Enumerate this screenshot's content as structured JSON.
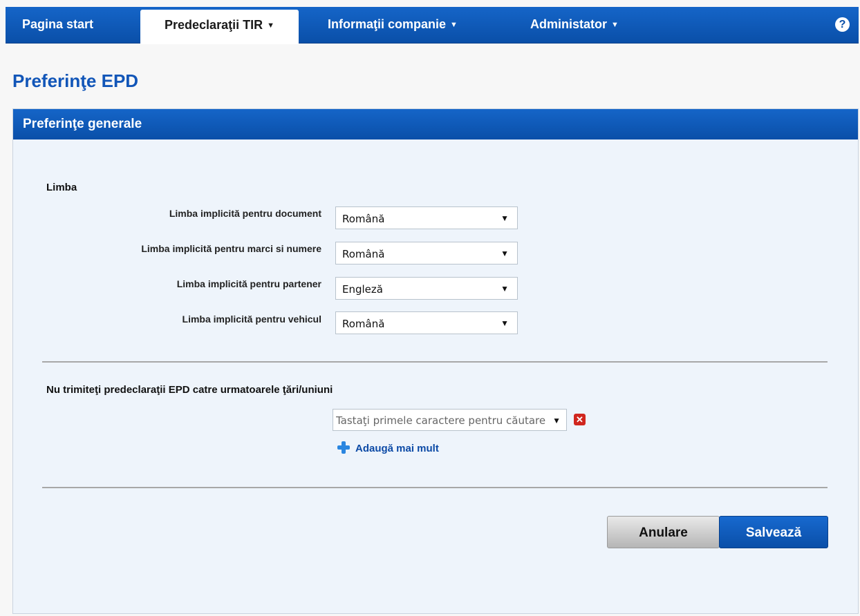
{
  "nav": {
    "items": [
      {
        "label": "Pagina start",
        "has_caret": false
      },
      {
        "label": "Predeclaraţii TIR",
        "has_caret": true,
        "active": true
      },
      {
        "label": "Informaţii companie",
        "has_caret": true
      },
      {
        "label": "Administator",
        "has_caret": true
      }
    ],
    "help_icon": "?"
  },
  "page": {
    "title": "Preferinţe EPD"
  },
  "panel": {
    "title": "Preferinţe generale",
    "language_section": {
      "heading": "Limba",
      "rows": [
        {
          "label": "Limba implicită pentru document",
          "value": "Română"
        },
        {
          "label": "Limba implicită pentru marci si numere",
          "value": "Română"
        },
        {
          "label": "Limba implicită pentru partener",
          "value": "Engleză"
        },
        {
          "label": "Limba implicită pentru vehicul",
          "value": "Română"
        }
      ]
    },
    "exclusion_section": {
      "heading": "Nu trimiteţi predeclaraţii EPD catre urmatoarele ţări/uniuni",
      "combo_placeholder": "Tastaţi primele caractere pentru căutare",
      "add_more": "Adaugă mai mult"
    },
    "buttons": {
      "cancel": "Anulare",
      "save": "Salvează"
    }
  },
  "colors": {
    "brand_blue": "#0a4fa8",
    "title_blue": "#1256b8",
    "panel_bg": "#eef4fb",
    "remove_red": "#d0261e"
  }
}
